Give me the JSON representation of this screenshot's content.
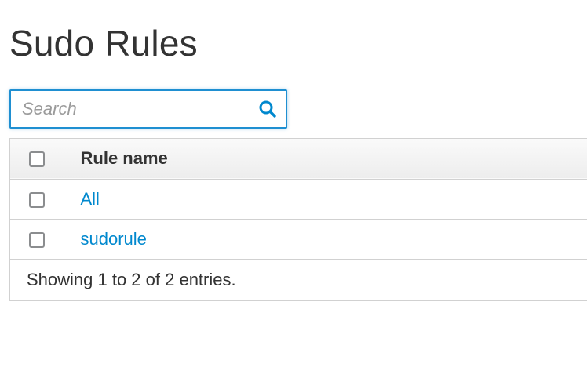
{
  "page": {
    "title": "Sudo Rules"
  },
  "search": {
    "placeholder": "Search",
    "value": "",
    "icon": "search-icon",
    "accent_color": "#1f8fd1"
  },
  "table": {
    "columns": [
      "Rule name"
    ],
    "rows": [
      {
        "name": "All",
        "checked": false
      },
      {
        "name": "sudorule",
        "checked": false
      }
    ],
    "footer": "Showing 1 to 2 of 2 entries.",
    "link_color": "#0088ce"
  }
}
